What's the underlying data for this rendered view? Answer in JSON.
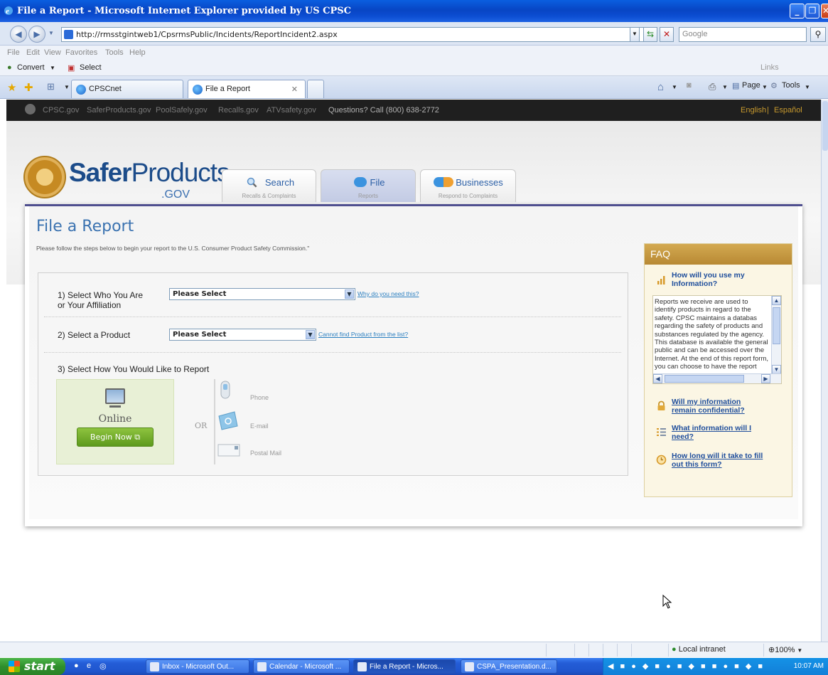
{
  "window": {
    "title": "File a Report - Microsoft Internet Explorer provided by US CPSC",
    "address": "http://rmsstgintweb1/CpsrmsPublic/Incidents/ReportIncident2.aspx",
    "search_placeholder": "Google",
    "menu": [
      "File",
      "Edit",
      "View",
      "Favorites",
      "Tools",
      "Help"
    ],
    "toolbar": {
      "convert": "Convert",
      "select": "Select",
      "links": "Links"
    },
    "tabs": [
      {
        "label": "CPSCnet"
      },
      {
        "label": "File a Report"
      }
    ],
    "tab_tools": {
      "page": "Page",
      "tools": "Tools"
    }
  },
  "cpsc_bar": {
    "links": [
      "CPSC.gov",
      "SaferProducts.gov",
      "PoolSafely.gov",
      "Recalls.gov",
      "ATVsafety.gov"
    ],
    "questions": "Questions? Call (800) 638-2772",
    "english": "English",
    "separator": "|",
    "espanol": "Español"
  },
  "site": {
    "logo_main_bold": "Safer",
    "logo_main": "Products",
    "logo_gov": ".GOV",
    "tabs": [
      {
        "label": "Search",
        "sub": "Recalls & Complaints"
      },
      {
        "label": "File",
        "sub": "Reports"
      },
      {
        "label": "Businesses",
        "sub": "Respond to Complaints"
      }
    ]
  },
  "form": {
    "title": "File a Report",
    "intro": "Please follow the steps below to begin your report to the U.S. Consumer Product Safety Commission.\"",
    "step1_line1": "1) Select Who You Are",
    "step1_line2": "or Your Affiliation",
    "step1_value": "Please Select",
    "step1_link": "Why do you need this?",
    "step2": "2) Select a Product",
    "step2_value": "Please Select",
    "step2_link": "Cannot find Product from the list?",
    "step3": "3) Select How You Would Like to Report",
    "online": "Online",
    "begin": "Begin Now",
    "or": "OR",
    "phone": "Phone",
    "email": "E-mail",
    "postal": "Postal Mail"
  },
  "faq": {
    "heading": "FAQ",
    "q1_line1": "How will you use my",
    "q1_line2": "Information?",
    "answer": "Reports we receive are used to identify products in regard to the safety. CPSC maintains a databas regarding the safety of products and substances regulated by the agency. This database is available the general public and can be accessed over the Internet. At the end of this report form, you can choose to have the report you",
    "q2_line1": "Will my information",
    "q2_line2": "remain confidential?",
    "q3_line1": "What information will I",
    "q3_line2": "need?",
    "q4_line1": "How long will it take to fill",
    "q4_line2": "out this form?"
  },
  "status": {
    "zone": "Local intranet",
    "zoom": "100%"
  },
  "taskbar": {
    "start": "start",
    "tasks": [
      "Inbox - Microsoft Out...",
      "Calendar - Microsoft ...",
      "File a Report - Micros...",
      "CSPA_Presentation.d..."
    ],
    "clock": "10:07 AM"
  }
}
